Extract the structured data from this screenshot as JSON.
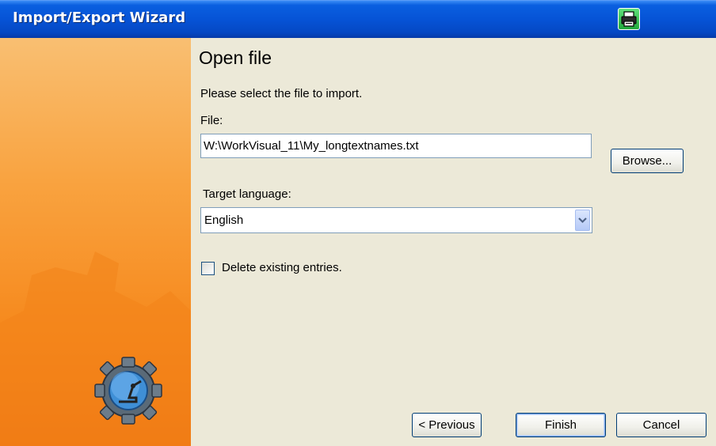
{
  "window": {
    "title": "Import/Export Wizard",
    "title_icon": "printer-icon"
  },
  "page": {
    "heading": "Open file",
    "instruction": "Please select the file to import.",
    "file_label": "File:",
    "file_value": "W:\\WorkVisual_11\\My_longtextnames.txt",
    "browse_label": "Browse...",
    "language_label": "Target language:",
    "language_value": "English",
    "delete_label": "Delete existing entries.",
    "delete_checked": false
  },
  "buttons": {
    "previous": "< Previous",
    "finish": "Finish",
    "cancel": "Cancel"
  },
  "colors": {
    "titlebar": "#0653d6",
    "panel_accent": "#f68a1e",
    "face": "#ece9d8"
  }
}
